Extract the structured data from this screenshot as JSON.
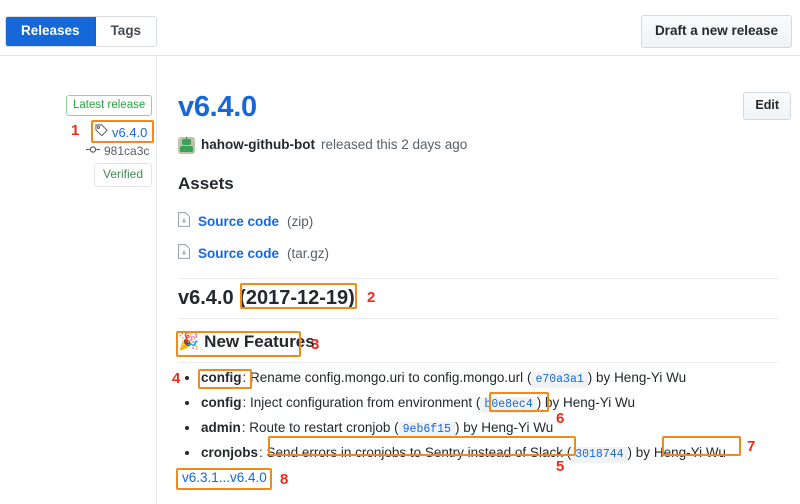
{
  "topbar": {
    "tabs": [
      {
        "label": "Releases",
        "active": true
      },
      {
        "label": "Tags",
        "active": false
      }
    ],
    "draft_button": "Draft a new release"
  },
  "sidebar": {
    "latest_badge": "Latest release",
    "tag_name": "v6.4.0",
    "commit_sha": "981ca3c",
    "verified_badge": "Verified",
    "tag_icon": "tag-icon",
    "commit_icon": "git-commit-icon"
  },
  "release": {
    "edit_button": "Edit",
    "title": "v6.4.0",
    "author": "hahow-github-bot",
    "byline_text": "released this 2 days ago",
    "avatar_icon": "bot-avatar-icon",
    "assets_heading": "Assets",
    "assets": [
      {
        "name": "Source code",
        "ext": "(zip)",
        "icon": "file-zip-icon"
      },
      {
        "name": "Source code",
        "ext": "(tar.gz)",
        "icon": "file-zip-icon"
      }
    ],
    "notes_heading_version": "v6.4.0 ",
    "notes_heading_date": "(2017-12-19)",
    "features_emoji": "🎉",
    "features_heading": "New Features",
    "changes": [
      {
        "scope": "config",
        "subject": "Rename config.mongo.uri to config.mongo.url",
        "sha": "e70a3a1",
        "author": "Heng-Yi Wu"
      },
      {
        "scope": "config",
        "subject": "Inject configuration from environment",
        "sha": "b0e8ec4",
        "author": "Heng-Yi Wu"
      },
      {
        "scope": "admin",
        "subject": "Route to restart cronjob",
        "sha": "9eb6f15",
        "author": "Heng-Yi Wu"
      },
      {
        "scope": "cronjobs",
        "subject": "Send errors in cronjobs to Sentry instead of Slack",
        "sha": "3018744",
        "author": "Heng-Yi Wu"
      }
    ],
    "compare_link": "v6.3.1...v6.4.0"
  },
  "annotations": {
    "accent_box_color": "#f08a1b",
    "number_color": "#ef2b18",
    "items": [
      {
        "number": "1",
        "target": "release-tag-name"
      },
      {
        "number": "2",
        "target": "release-notes-date"
      },
      {
        "number": "3",
        "target": "new-features-heading"
      },
      {
        "number": "4",
        "target": "change-scope-config"
      },
      {
        "number": "5",
        "target": "change-subject-cronjobs"
      },
      {
        "number": "6",
        "target": "change-sha-parenthetical"
      },
      {
        "number": "7",
        "target": "change-author-name"
      },
      {
        "number": "8",
        "target": "compare-link"
      }
    ]
  }
}
